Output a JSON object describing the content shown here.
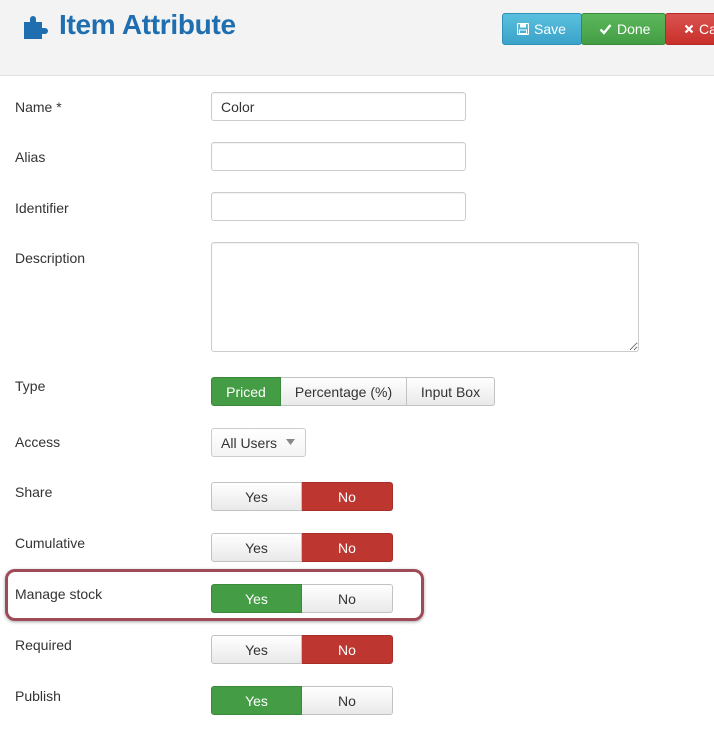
{
  "header": {
    "title": "Item Attribute",
    "icon": "puzzle-icon",
    "accent_color": "#1f6eb0",
    "buttons": {
      "save": "Save",
      "done": "Done",
      "cancel": "Ca"
    }
  },
  "form": {
    "name": {
      "label": "Name *",
      "value": "Color",
      "placeholder": ""
    },
    "alias": {
      "label": "Alias",
      "value": "",
      "placeholder": ""
    },
    "identifier": {
      "label": "Identifier",
      "value": "",
      "placeholder": ""
    },
    "description": {
      "label": "Description",
      "value": ""
    },
    "type": {
      "label": "Type",
      "options": [
        "Priced",
        "Percentage (%)",
        "Input Box"
      ],
      "selected": "Priced"
    },
    "access": {
      "label": "Access",
      "selected": "All Users"
    },
    "share": {
      "label": "Share",
      "yes": "Yes",
      "no": "No",
      "selected": "No"
    },
    "cumulative": {
      "label": "Cumulative",
      "yes": "Yes",
      "no": "No",
      "selected": "No"
    },
    "manage_stock": {
      "label": "Manage stock",
      "yes": "Yes",
      "no": "No",
      "selected": "Yes",
      "highlighted": true
    },
    "required": {
      "label": "Required",
      "yes": "Yes",
      "no": "No",
      "selected": "No"
    },
    "publish": {
      "label": "Publish",
      "yes": "Yes",
      "no": "No",
      "selected": "Yes"
    }
  },
  "colors": {
    "active_yes": "#449d44",
    "active_no": "#bd362f",
    "save_button": "#3aa3c9",
    "highlight_border": "#9e4a57"
  }
}
